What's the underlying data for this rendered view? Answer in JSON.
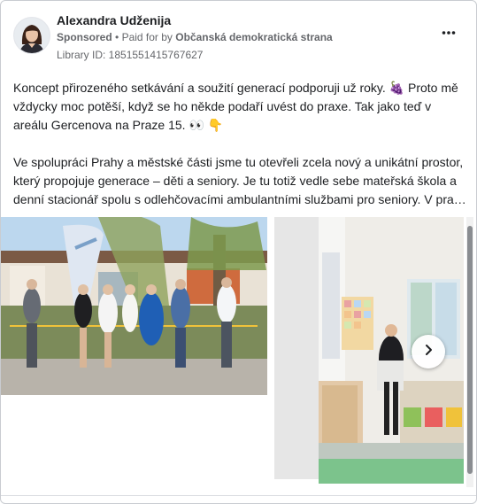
{
  "post": {
    "author_name": "Alexandra Udženija",
    "sponsored": "Sponsored",
    "paid_for_prefix": "Paid for by",
    "payer": "Občanská demokratická strana",
    "library_id": "Library ID: 1851551415767627",
    "more_icon": "more-horizontal-icon",
    "paragraph1": "Koncept přirozeného setkávání a soužití generací podporuji už roky. 🍇 Proto mě vždycky moc potěší, když se ho někde podaří uvést do praxe. Tak jako teď v areálu Gercenova na Praze 15. 👀 👇",
    "paragraph2_line1": "Ve spolupráci Prahy a městské části jsme tu otevřeli zcela nový a unikátní prostor,",
    "paragraph2_line2": "který propojuje generace – děti a seniory. Je tu totiž vedle sebe mateřská škola a",
    "paragraph2_line3": "denní stacionář spolu s odlehčovacími ambulantními službami pro seniory. V pra…"
  },
  "carousel": {
    "next_icon": "chevron-right-icon"
  },
  "colors": {
    "text_primary": "#1c1e21",
    "text_secondary": "#65676b",
    "border": "#c9ccd1"
  }
}
